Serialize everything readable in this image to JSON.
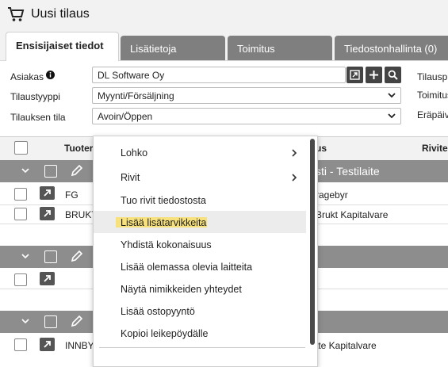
{
  "app": {
    "title": "Uusi tilaus"
  },
  "tabs": [
    {
      "label": "Ensisijaiset tiedot"
    },
    {
      "label": "Lisätietoja"
    },
    {
      "label": "Toimitus"
    },
    {
      "label": "Tiedostonhallinta (0)"
    }
  ],
  "form": {
    "customer_label": "Asiakas",
    "customer_value": "DL Software Oy",
    "order_type_label": "Tilaustyyppi",
    "order_type_value": "Myynti/Försäljning",
    "order_status_label": "Tilauksen tila",
    "order_status_value": "Avoin/Öppen",
    "right_labels": [
      "Tilausp",
      "Toimitus",
      "Eräpäiv"
    ]
  },
  "table": {
    "headers": {
      "product": "Tuoter",
      "name": "us",
      "row": "Rivite"
    },
    "group1_title": "sti - Testilaite",
    "rows": [
      {
        "code": "FG",
        "name": "ragebyr"
      },
      {
        "code": "BRUKT",
        "name": "Brukt Kapitalvare"
      }
    ],
    "last_row": {
      "code": "INNBY",
      "name": "tte Kapitalvare"
    }
  },
  "context_menu": {
    "items": [
      {
        "label": "Lohko",
        "submenu": true
      },
      {
        "label": "Rivit",
        "submenu": true
      },
      {
        "label": "Tuo rivit tiedostosta"
      },
      {
        "label": "Lisää lisätarvikkeita"
      },
      {
        "label": "Yhdistä kokonaisuus"
      },
      {
        "label": "Lisää olemassa olevia laitteita"
      },
      {
        "label": "Näytä nimikkeiden yhteydet"
      },
      {
        "label": "Lisää ostopyyntö"
      },
      {
        "label": "Kopioi leikepöydälle"
      }
    ]
  },
  "colors": {
    "tab_inactive": "#7f7f7f",
    "group_row": "#8d8d8d",
    "highlight": "#f7e17c"
  }
}
